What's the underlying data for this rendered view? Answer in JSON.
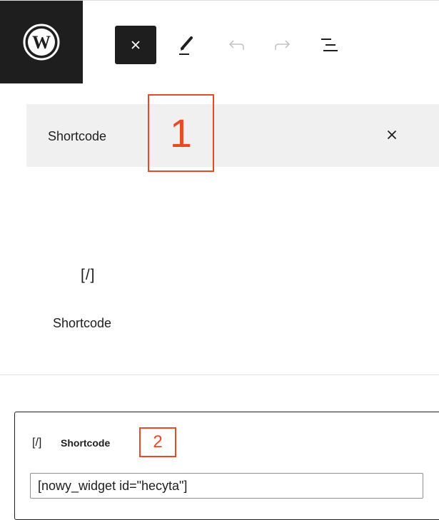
{
  "toolbar": {
    "logo_icon": "wordpress-logo",
    "close_icon": "close-icon",
    "pencil_icon": "pencil-icon",
    "undo_icon": "undo-icon",
    "redo_icon": "redo-icon",
    "outline_icon": "list-view-icon"
  },
  "inserter": {
    "search_value": "Shortcode",
    "clear_icon": "close-icon"
  },
  "results": {
    "items": [
      {
        "icon_glyph": "[/]",
        "label": "Shortcode"
      }
    ]
  },
  "annotations": {
    "first": "1",
    "second": "2",
    "color": "#e84a26"
  },
  "shortcode_block": {
    "icon_glyph": "[/]",
    "title": "Shortcode",
    "input_value": "[nowy_widget id=\"hecyta\"]"
  }
}
